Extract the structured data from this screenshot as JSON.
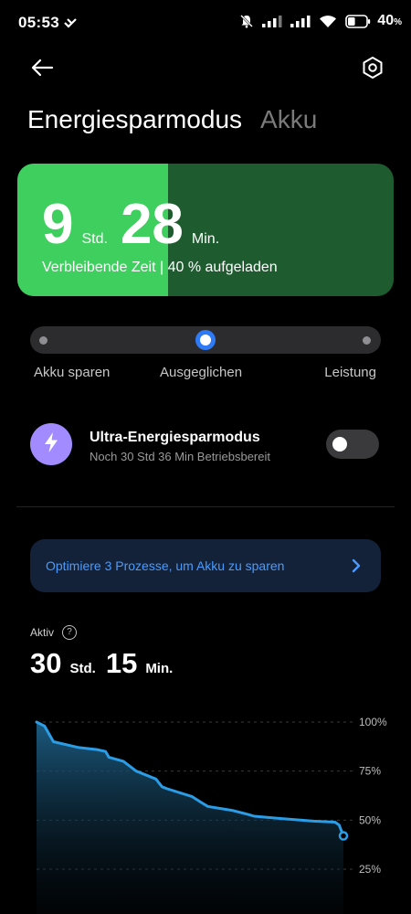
{
  "status_bar": {
    "time": "05:53",
    "battery_percent": "40",
    "battery_unit": "%"
  },
  "header": {
    "tabs": [
      {
        "label": "Energiesparmodus",
        "active": true
      },
      {
        "label": "Akku",
        "active": false
      }
    ]
  },
  "remaining": {
    "hours": "9",
    "hours_unit": "Std.",
    "minutes": "28",
    "minutes_unit": "Min.",
    "subtitle": "Verbleibende Zeit | 40 % aufgeladen",
    "charge_fraction": 0.4,
    "colors": {
      "fill": "#3fcf5f",
      "rest": "#1e5c30"
    }
  },
  "mode": {
    "options": [
      "Akku sparen",
      "Ausgeglichen",
      "Leistung"
    ],
    "selected_index": 1,
    "accent": "#2f7bf5"
  },
  "ultra": {
    "icon": "lightning-icon",
    "title": "Ultra-Energiesparmodus",
    "subtitle": "Noch 30 Std 36 Min Betriebsbereit",
    "enabled": false,
    "icon_color": "#a28bff"
  },
  "optimize": {
    "text": "Optimiere 3 Prozesse, um Akku zu sparen",
    "icon": "chevron-right-icon",
    "accent": "#4a9bff"
  },
  "active": {
    "label": "Aktiv",
    "help_icon": "question-icon",
    "hours": "30",
    "hours_unit": "Std.",
    "minutes": "15",
    "minutes_unit": "Min."
  },
  "chart_data": {
    "type": "area",
    "title": "",
    "xlabel": "",
    "ylabel": "",
    "ylim": [
      0,
      100
    ],
    "y_ticks": [
      "100%",
      "75%",
      "50%",
      "25%"
    ],
    "y_tick_values": [
      100,
      75,
      50,
      25
    ],
    "grid": "horizontal dashed",
    "line_color": "#2a9de6",
    "series": [
      {
        "x": [
          0,
          2.6,
          5.5,
          13.8,
          19.7,
          22.5,
          23.6,
          28.3,
          32.5,
          38.9,
          40.9,
          42.6,
          50.7,
          53.7,
          55.8,
          63.7,
          68.8,
          70.9,
          78.5,
          90.2,
          97.3,
          98.6,
          100
        ],
        "values": [
          100,
          98,
          90,
          87,
          86,
          85,
          82,
          80,
          75,
          71,
          67,
          66,
          62,
          59,
          57,
          55,
          53,
          52,
          51,
          49.5,
          49,
          47.5,
          42
        ]
      }
    ]
  }
}
